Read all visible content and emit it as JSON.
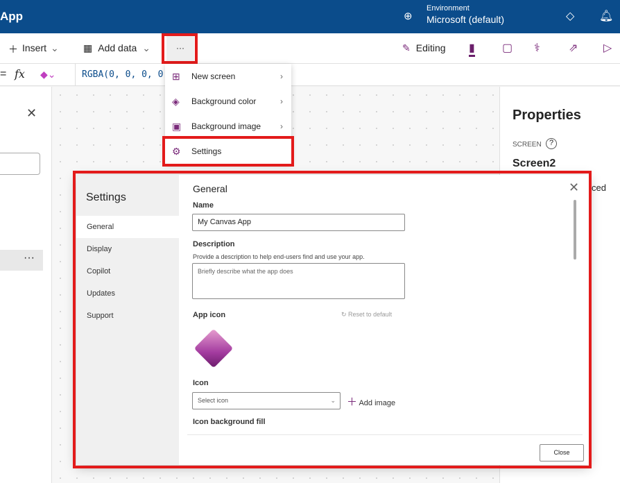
{
  "header": {
    "app_title": "App",
    "env_label": "Environment",
    "env_value": "Microsoft (default)"
  },
  "toolbar": {
    "insert": "Insert",
    "add_data": "Add data",
    "more": "···",
    "editing": "Editing"
  },
  "formula": {
    "fx": "fx",
    "value": "RGBA(0, 0, 0, 0"
  },
  "menu": {
    "items": [
      {
        "label": "New screen"
      },
      {
        "label": "Background color"
      },
      {
        "label": "Background image"
      },
      {
        "label": "Settings"
      }
    ]
  },
  "properties": {
    "title": "Properties",
    "screen_label": "SCREEN",
    "screen_name": "Screen2",
    "tab_partial": "ced"
  },
  "settings": {
    "title": "Settings",
    "nav": [
      "General",
      "Display",
      "Copilot",
      "Updates",
      "Support"
    ],
    "section": "General",
    "name_label": "Name",
    "name_value": "My Canvas App",
    "desc_label": "Description",
    "desc_help": "Provide a description to help end-users find and use your app.",
    "desc_placeholder": "Briefly describe what the app does",
    "app_icon_label": "App icon",
    "reset": "Reset to default",
    "icon_label": "Icon",
    "icon_placeholder": "Select icon",
    "add_image": "Add image",
    "icon_bg_label": "Icon background fill",
    "close": "Close"
  }
}
